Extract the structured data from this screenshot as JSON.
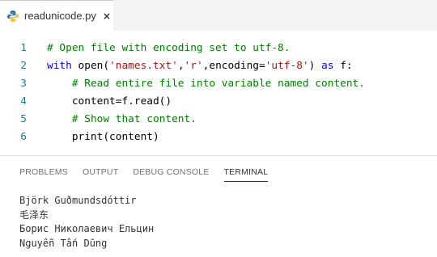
{
  "tab": {
    "icon": "python-icon",
    "filename": "readunicode.py",
    "close_label": "×"
  },
  "editor": {
    "lines": [
      {
        "number": "1",
        "tokens": [
          {
            "t": "# Open file with encoding set to utf-8.",
            "c": "cm"
          }
        ]
      },
      {
        "number": "2",
        "tokens": [
          {
            "t": "with",
            "c": "kw"
          },
          {
            "t": " open(",
            "c": "code"
          },
          {
            "t": "'names.txt'",
            "c": "str"
          },
          {
            "t": ",",
            "c": "code"
          },
          {
            "t": "'r'",
            "c": "str"
          },
          {
            "t": ",encoding=",
            "c": "code"
          },
          {
            "t": "'utf-8'",
            "c": "str"
          },
          {
            "t": ") ",
            "c": "code"
          },
          {
            "t": "as",
            "c": "kw"
          },
          {
            "t": " f:",
            "c": "code"
          }
        ]
      },
      {
        "number": "3",
        "tokens": [
          {
            "t": "    ",
            "c": "code"
          },
          {
            "t": "# Read entire file into variable named content.",
            "c": "cm"
          }
        ]
      },
      {
        "number": "4",
        "tokens": [
          {
            "t": "    content=f.read()",
            "c": "code"
          }
        ]
      },
      {
        "number": "5",
        "tokens": [
          {
            "t": "    ",
            "c": "code"
          },
          {
            "t": "# Show that content.",
            "c": "cm"
          }
        ]
      },
      {
        "number": "6",
        "tokens": [
          {
            "t": "    print(content)",
            "c": "code"
          }
        ]
      }
    ]
  },
  "panel": {
    "tabs": [
      "PROBLEMS",
      "OUTPUT",
      "DEBUG CONSOLE",
      "TERMINAL"
    ],
    "active_tab": "TERMINAL"
  },
  "terminal": {
    "lines": [
      "Björk Guðmundsdóttir",
      "毛泽东",
      "Борис Николаевич Ельцин",
      "Nguyễn Tấn Dũng"
    ]
  },
  "colors": {
    "comment": "#008000",
    "keyword": "#0000ff",
    "string": "#a31515",
    "line_number": "#237893"
  }
}
